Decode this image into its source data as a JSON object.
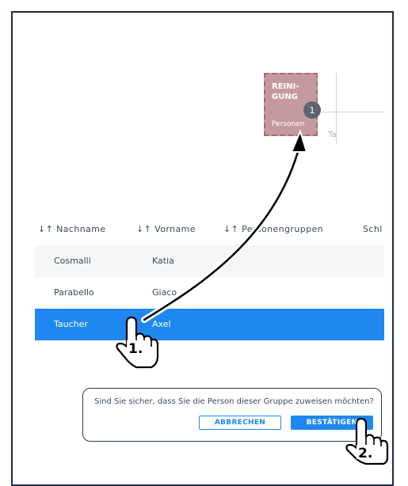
{
  "group_tile": {
    "title_line1": "REINI-",
    "title_line2": "GUNG",
    "subtitle": "Personen",
    "count_badge": "1",
    "neighbor_text": "Ta"
  },
  "table": {
    "columns": [
      {
        "sort_icon": "↓↑",
        "label": "Nachname"
      },
      {
        "sort_icon": "↓↑",
        "label": "Vorname"
      },
      {
        "sort_icon": "↓↑",
        "label": "Personengruppen"
      },
      {
        "sort_icon": "",
        "label": "Schl"
      }
    ],
    "rows": [
      {
        "nachname": "Cosmalli",
        "vorname": "Katia",
        "selected": false
      },
      {
        "nachname": "Parabello",
        "vorname": "Giaco",
        "selected": false
      },
      {
        "nachname": "Taucher",
        "vorname": "Axel",
        "selected": true
      }
    ]
  },
  "dialog": {
    "message": "Sind Sie sicher, dass Sie die Person dieser Gruppe zuweisen möchten?",
    "cancel_label": "ABBRECHEN",
    "confirm_label": "BESTÄTIGEN"
  },
  "annotations": {
    "step1": "1.",
    "step2": "2.",
    "icons": [
      "hand-pointer-icon",
      "drag-arrow-icon"
    ]
  },
  "colors": {
    "frame": "#1f2a4a",
    "accent": "#1e88f0",
    "tile": "#c59a9e",
    "badge": "#5b6672"
  }
}
